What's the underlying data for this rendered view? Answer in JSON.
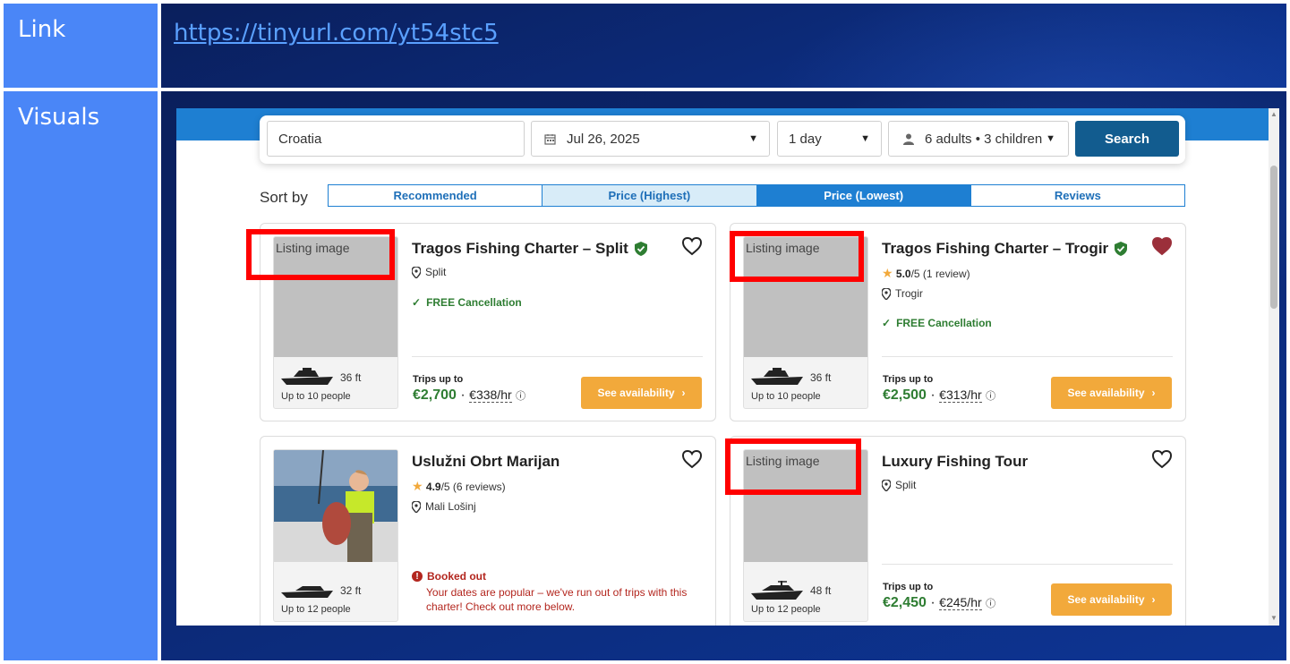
{
  "slide": {
    "link_label": "Link",
    "link_url": "https://tinyurl.com/yt54stc5",
    "visuals_label": "Visuals"
  },
  "search": {
    "destination": "Croatia",
    "date": "Jul 26, 2025",
    "duration": "1 day",
    "guests": "6 adults • 3 children",
    "search_label": "Search"
  },
  "sort": {
    "label": "Sort by",
    "options": [
      "Recommended",
      "Price (Highest)",
      "Price (Lowest)",
      "Reviews"
    ],
    "active": "Price (Lowest)"
  },
  "listings": [
    {
      "image_alt": "Listing image",
      "title": "Tragos Fishing Charter – Split",
      "verified": true,
      "favorited": false,
      "location": "Split",
      "free_cancellation": "FREE Cancellation",
      "boat_length": "36 ft",
      "capacity": "Up to 10 people",
      "trips_label": "Trips up to",
      "price": "€2,700",
      "price_sep": " · ",
      "hourly": "€338/hr",
      "cta": "See availability"
    },
    {
      "image_alt": "Listing image",
      "title": "Tragos Fishing Charter – Trogir",
      "verified": true,
      "favorited": true,
      "rating_value": "5.0",
      "rating_rest": "/5 (1 review)",
      "location": "Trogir",
      "free_cancellation": "FREE Cancellation",
      "boat_length": "36 ft",
      "capacity": "Up to 10 people",
      "trips_label": "Trips up to",
      "price": "€2,500",
      "price_sep": " · ",
      "hourly": "€313/hr",
      "cta": "See availability"
    },
    {
      "title": "Uslužni Obrt Marijan",
      "favorited": false,
      "rating_value": "4.9",
      "rating_rest": "/5 (6 reviews)",
      "location": "Mali Lošinj",
      "boat_length": "32 ft",
      "capacity": "Up to 12 people",
      "booked_title": "Booked out",
      "booked_message": "Your dates are popular – we've run out of trips with this charter! Check out more below."
    },
    {
      "image_alt": "Listing image",
      "title": "Luxury Fishing Tour",
      "favorited": false,
      "location": "Split",
      "boat_length": "48 ft",
      "capacity": "Up to 12 people",
      "trips_label": "Trips up to",
      "price": "€2,450",
      "price_sep": " · ",
      "hourly": "€245/hr",
      "cta": "See availability"
    }
  ],
  "colors": {
    "label_cell": "#4a86f7",
    "value_cell": "#0a1f5c",
    "brand_blue": "#1e7fd2",
    "search_button": "#125c8f",
    "cta_orange": "#f2a93b",
    "price_green": "#2e7d32",
    "highlight_red": "#ff0000"
  }
}
